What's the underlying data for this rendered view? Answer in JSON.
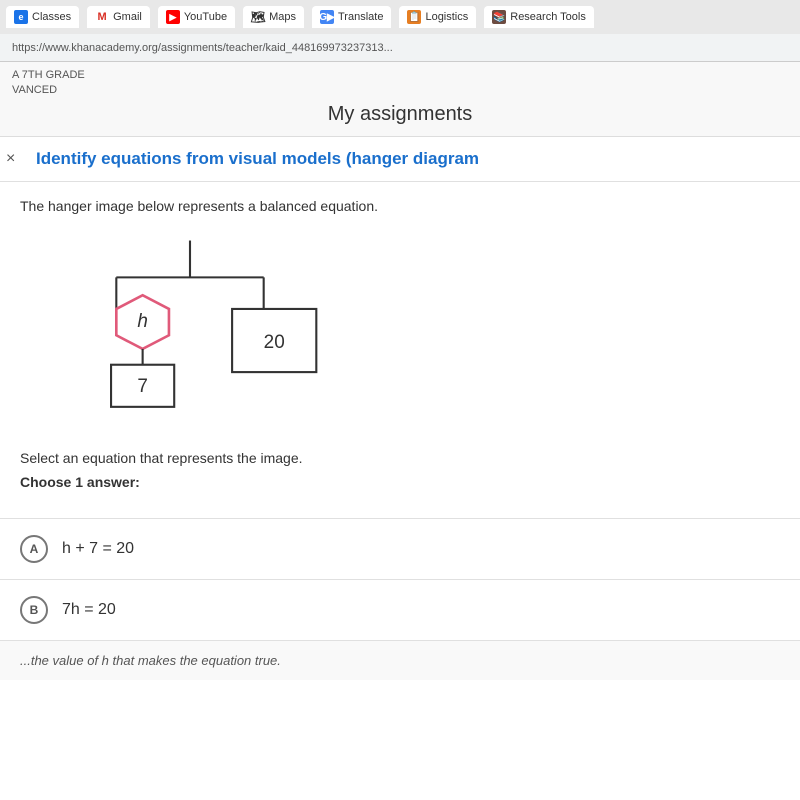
{
  "browser": {
    "url": "https://www.khanacademy.org/assignments/teacher/kaid_448169973237313...",
    "tabs": [
      {
        "id": "classes",
        "label": "Classes",
        "favicon_type": "blue",
        "favicon_text": "e"
      },
      {
        "id": "gmail",
        "label": "Gmail",
        "favicon_type": "gmail",
        "favicon_text": "M"
      },
      {
        "id": "youtube",
        "label": "YouTube",
        "favicon_type": "youtube",
        "favicon_text": "▶"
      },
      {
        "id": "maps",
        "label": "Maps",
        "favicon_type": "maps",
        "favicon_text": "📍"
      },
      {
        "id": "translate",
        "label": "Translate",
        "favicon_type": "translate",
        "favicon_text": "G"
      },
      {
        "id": "logistics",
        "label": "Logistics",
        "favicon_type": "logistics",
        "favicon_text": "📄"
      },
      {
        "id": "research",
        "label": "Research Tools",
        "favicon_type": "research",
        "favicon_text": "📚"
      }
    ]
  },
  "page": {
    "breadcrumb_line1": "A 7TH GRADE",
    "breadcrumb_line2": "VANCED",
    "page_title": "My assignments"
  },
  "question": {
    "title": "Identify equations from visual models (hanger diagram",
    "close_label": "×",
    "description": "The hanger image below represents a balanced equation.",
    "select_prompt": "Select an equation that represents the image.",
    "choose_label": "Choose 1 answer:",
    "options": [
      {
        "id": "A",
        "text": "h + 7 = 20"
      },
      {
        "id": "B",
        "text": "7h = 20"
      }
    ],
    "footer_hint": "...the value of h that makes the equation true."
  },
  "hanger": {
    "left_label": "h",
    "left_bottom_label": "7",
    "right_label": "20"
  }
}
